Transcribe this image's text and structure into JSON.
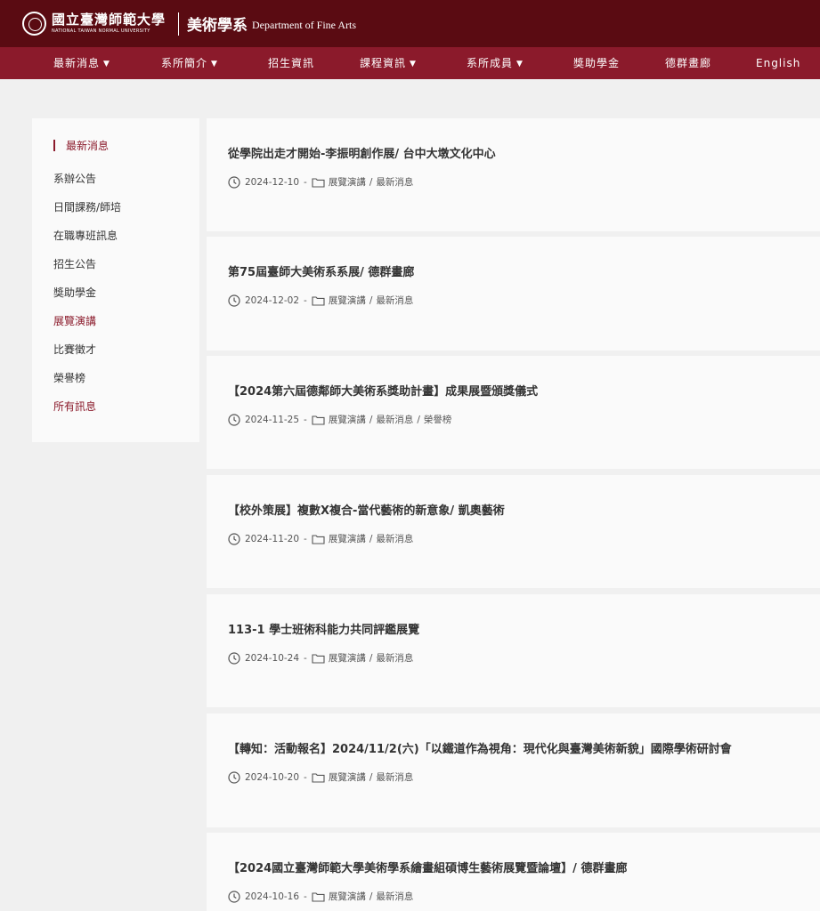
{
  "header": {
    "university_zh": "國立臺灣師範大學",
    "university_en": "NATIONAL TAIWAN NORMAL UNIVERSITY",
    "dept_zh": "美術學系",
    "dept_en": "Department of Fine Arts"
  },
  "nav": [
    {
      "label": "最新消息",
      "dropdown": true
    },
    {
      "label": "系所簡介",
      "dropdown": true
    },
    {
      "label": "招生資訊",
      "dropdown": false
    },
    {
      "label": "課程資訊",
      "dropdown": true
    },
    {
      "label": "系所成員",
      "dropdown": true
    },
    {
      "label": "獎助學金",
      "dropdown": false
    },
    {
      "label": "德群畫廊",
      "dropdown": false
    },
    {
      "label": "English",
      "dropdown": false
    }
  ],
  "sidebar": {
    "items": [
      {
        "label": "最新消息"
      },
      {
        "label": "系辦公告"
      },
      {
        "label": "日間課務/師培"
      },
      {
        "label": "在職專班訊息"
      },
      {
        "label": "招生公告"
      },
      {
        "label": "獎助學金"
      },
      {
        "label": "展覽演講"
      },
      {
        "label": "比賽徵才"
      },
      {
        "label": "榮譽榜"
      },
      {
        "label": "所有訊息"
      }
    ]
  },
  "posts": [
    {
      "title": "從學院出走才開始-李振明創作展/ 台中大墩文化中心",
      "date": "2024-12-10",
      "sep": "-",
      "categories": [
        "展覽演講",
        "最新消息"
      ]
    },
    {
      "title": "第75屆臺師大美術系系展/ 德群畫廊",
      "date": "2024-12-02",
      "sep": "-",
      "categories": [
        "展覽演講",
        "最新消息"
      ]
    },
    {
      "title": "【2024第六屆德鄰師大美術系獎助計畫】成果展暨頒獎儀式",
      "date": "2024-11-25",
      "sep": "-",
      "categories": [
        "展覽演講",
        "最新消息",
        "榮譽榜"
      ]
    },
    {
      "title": "【校外策展】複數X複合-當代藝術的新意象/ 凱奧藝術",
      "date": "2024-11-20",
      "sep": "-",
      "categories": [
        "展覽演講",
        "最新消息"
      ]
    },
    {
      "title": "113-1 學士班術科能力共同評鑑展覽",
      "date": "2024-10-24",
      "sep": "-",
      "categories": [
        "展覽演講",
        "最新消息"
      ]
    },
    {
      "title": "【轉知：活動報名】2024/11/2(六)「以鐵道作為視角：現代化與臺灣美術新貌」國際學術研討會",
      "date": "2024-10-20",
      "sep": "-",
      "categories": [
        "展覽演講",
        "最新消息"
      ]
    },
    {
      "title": "【2024國立臺灣師範大學美術學系繪畫組碩博生藝術展覽暨論壇】/ 德群畫廊",
      "date": "2024-10-16",
      "sep": "-",
      "categories": [
        "展覽演講",
        "最新消息"
      ]
    }
  ],
  "colors": {
    "topbar": "#5a0b12",
    "navbar": "#8b1a2b",
    "accent": "#8b1a2b",
    "background": "#f0f0f0",
    "card": "#fafafa"
  },
  "icons": {
    "post_date": "clock-icon",
    "post_category": "folder-icon",
    "nav_dropdown": "chevron-down-icon",
    "logo": "university-seal-icon"
  }
}
